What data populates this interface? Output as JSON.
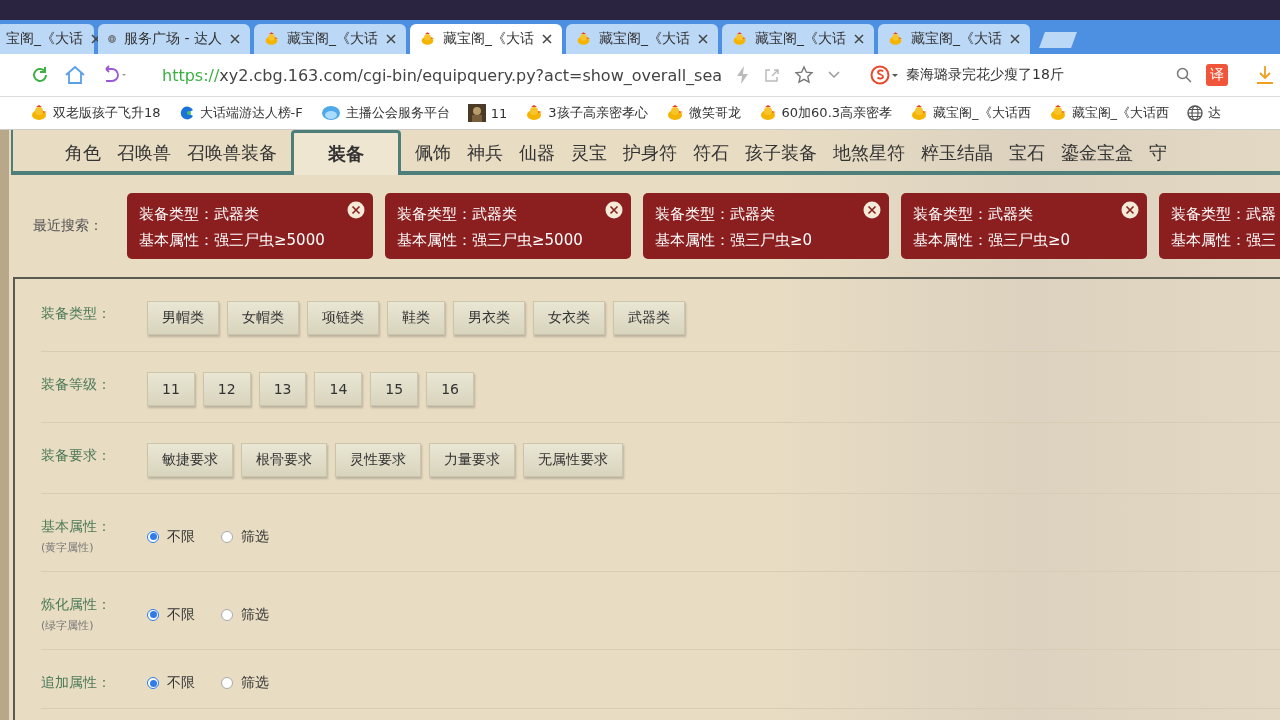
{
  "browser": {
    "tabs": [
      {
        "title": "宝阁_《大话",
        "kind": "plain",
        "selected": false
      },
      {
        "title": "服务广场 - 达人",
        "kind": "globe",
        "selected": false
      },
      {
        "title": "藏宝阁_《大话",
        "kind": "chick",
        "selected": false
      },
      {
        "title": "藏宝阁_《大话",
        "kind": "chick",
        "selected": true
      },
      {
        "title": "藏宝阁_《大话",
        "kind": "chick",
        "selected": false
      },
      {
        "title": "藏宝阁_《大话",
        "kind": "chick",
        "selected": false
      },
      {
        "title": "藏宝阁_《大话",
        "kind": "chick",
        "selected": false
      }
    ],
    "url_scheme": "https://",
    "url_rest": "xy2.cbg.163.com/cgi-bin/equipquery.py?act=show_overall_sea",
    "search": "秦海璐录完花少瘦了18斤",
    "translate": "译",
    "bookmarks": [
      {
        "label": "双老版孩子飞升18",
        "kind": "chick"
      },
      {
        "label": "大话端游达人榜-F",
        "kind": "swirl"
      },
      {
        "label": "主播公会服务平台",
        "kind": "bubble"
      },
      {
        "label": "11",
        "kind": "picture"
      },
      {
        "label": "3孩子高亲密孝心",
        "kind": "chick"
      },
      {
        "label": "微笑哥龙",
        "kind": "chick"
      },
      {
        "label": "60加60.3高亲密孝",
        "kind": "chick"
      },
      {
        "label": "藏宝阁_《大话西",
        "kind": "chick"
      },
      {
        "label": "藏宝阁_《大话西",
        "kind": "chick"
      },
      {
        "label": "达",
        "kind": "globe"
      }
    ]
  },
  "nav_tabs": [
    {
      "label": "角色",
      "selected": false
    },
    {
      "label": "召唤兽",
      "selected": false
    },
    {
      "label": "召唤兽装备",
      "selected": false
    },
    {
      "label": "装备",
      "selected": true
    },
    {
      "label": "佩饰",
      "selected": false
    },
    {
      "label": "神兵",
      "selected": false
    },
    {
      "label": "仙器",
      "selected": false
    },
    {
      "label": "灵宝",
      "selected": false
    },
    {
      "label": "护身符",
      "selected": false
    },
    {
      "label": "符石",
      "selected": false
    },
    {
      "label": "孩子装备",
      "selected": false
    },
    {
      "label": "地煞星符",
      "selected": false
    },
    {
      "label": "粹玉结晶",
      "selected": false
    },
    {
      "label": "宝石",
      "selected": false
    },
    {
      "label": "鎏金宝盒",
      "selected": false
    },
    {
      "label": "守",
      "selected": false
    }
  ],
  "recent": {
    "label": "最近搜索：",
    "items": [
      {
        "line_1": "装备类型：武器类",
        "line_2": "基本属性：强三尸虫≥5000"
      },
      {
        "line_1": "装备类型：武器类",
        "line_2": "基本属性：强三尸虫≥5000"
      },
      {
        "line_1": "装备类型：武器类",
        "line_2": "基本属性：强三尸虫≥0"
      },
      {
        "line_1": "装备类型：武器类",
        "line_2": "基本属性：强三尸虫≥0"
      },
      {
        "line_1": "装备类型：武器",
        "line_2": "基本属性：强三"
      }
    ]
  },
  "filters": [
    {
      "kind": "buttons",
      "label": "装备类型：",
      "options": [
        "男帽类",
        "女帽类",
        "项链类",
        "鞋类",
        "男衣类",
        "女衣类",
        "武器类"
      ]
    },
    {
      "kind": "buttons",
      "label": "装备等级：",
      "options": [
        "11",
        "12",
        "13",
        "14",
        "15",
        "16"
      ]
    },
    {
      "kind": "buttons",
      "label": "装备要求：",
      "options": [
        "敏捷要求",
        "根骨要求",
        "灵性要求",
        "力量要求",
        "无属性要求"
      ]
    },
    {
      "kind": "radio",
      "label": "基本属性：",
      "note": "(黄字属性)",
      "options": [
        {
          "label": "不限",
          "selected": true
        },
        {
          "label": "筛选",
          "selected": false
        }
      ]
    },
    {
      "kind": "radio",
      "label": "炼化属性：",
      "note": "(绿字属性)",
      "options": [
        {
          "label": "不限",
          "selected": true
        },
        {
          "label": "筛选",
          "selected": false
        }
      ]
    },
    {
      "kind": "radio",
      "label": "追加属性：",
      "options": [
        {
          "label": "不限",
          "selected": true
        },
        {
          "label": "筛选",
          "selected": false
        }
      ]
    }
  ]
}
